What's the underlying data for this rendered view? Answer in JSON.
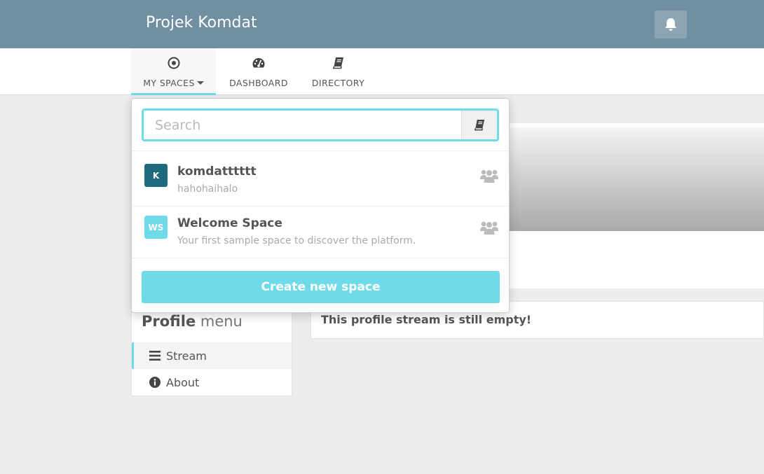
{
  "app": {
    "title": "Projek Komdat"
  },
  "nav": {
    "items": [
      {
        "label": "MY SPACES",
        "icon": "dot-circle-icon"
      },
      {
        "label": "DASHBOARD",
        "icon": "tachometer-icon"
      },
      {
        "label": "DIRECTORY",
        "icon": "book-icon"
      }
    ]
  },
  "dropdown": {
    "search_placeholder": "Search",
    "spaces": [
      {
        "avatar": "K",
        "name": "komdatttttt",
        "description": "hahohaihalo",
        "color": "#1d6b7c"
      },
      {
        "avatar": "WS",
        "name": "Welcome Space",
        "description": "Your first sample space to discover the platform.",
        "color": "#6fdbe8"
      }
    ],
    "create_label": "Create new space"
  },
  "stream": {
    "empty_text": "This profile stream is still empty!"
  },
  "profile_menu": {
    "title_bold": "Profile",
    "title_light": "menu",
    "items": [
      {
        "label": "Stream",
        "icon": "bars-icon"
      },
      {
        "label": "About",
        "icon": "info-circle-icon"
      }
    ]
  },
  "colors": {
    "topbar": "#708fa0",
    "accent": "#6fdbe8"
  }
}
